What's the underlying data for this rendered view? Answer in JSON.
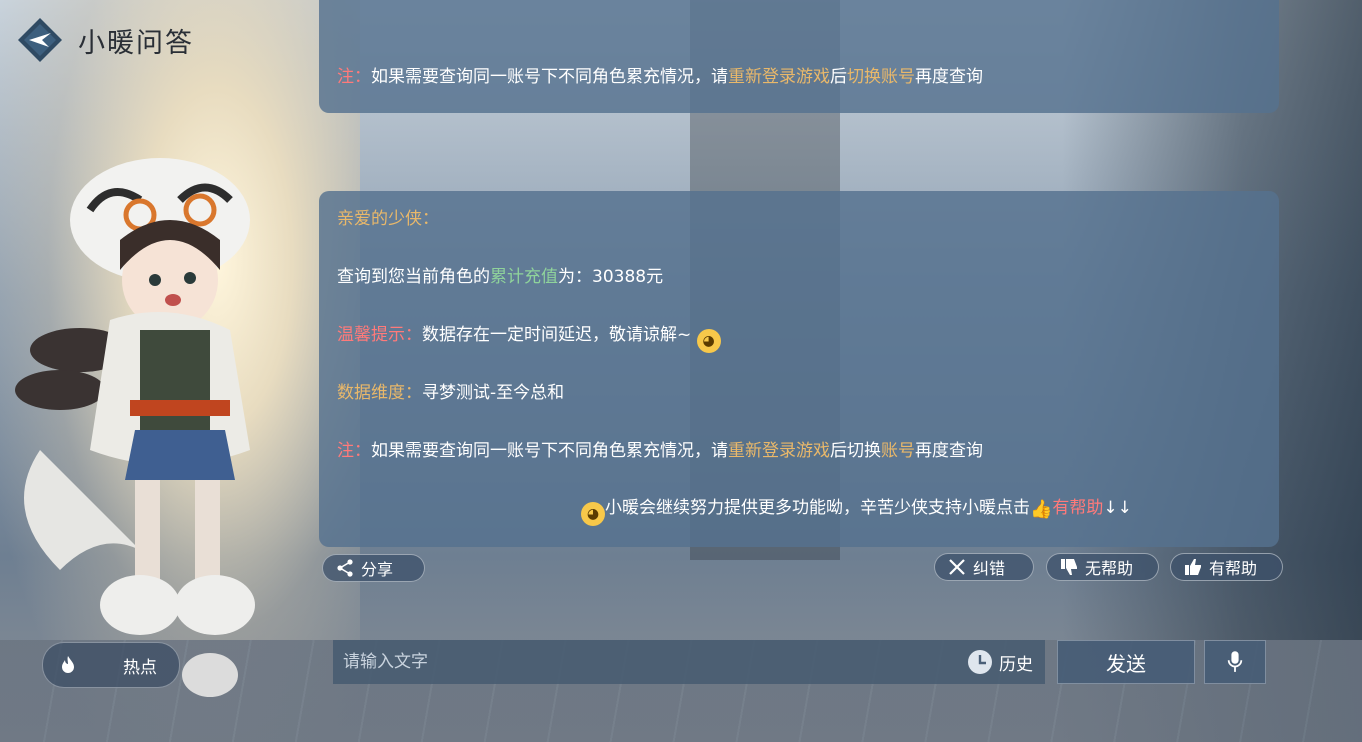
{
  "header": {
    "title": "小暖问答",
    "logo_icon": "diamond-logo-icon"
  },
  "prev_message": {
    "note_label": "注：",
    "text_a": "如果需要查询同一账号下不同角色累充情况，请",
    "hl1": "重新登录游戏",
    "text_b": "后",
    "hl2": "切换账号",
    "text_c": "再度查询"
  },
  "message": {
    "greeting": "亲爱的少侠：",
    "query_pre": "查询到您当前角色的",
    "query_hl": "累计充值",
    "query_post": "为：30388元",
    "tip_label": "温馨提示：",
    "tip_text": "数据存在一定时间延迟，敬请谅解~",
    "dim_label": "数据维度：",
    "dim_text": "寻梦测试-至今总和",
    "note_label": "注：",
    "note_a": "如果需要查询同一账号下不同角色累充情况，请",
    "note_hl1": "重新登录游戏",
    "note_b": "后切换",
    "note_hl2": "账号",
    "note_c": "再度查询",
    "footer_text": "小暖会继续努力提供更多功能呦，辛苦少侠支持小暖点击",
    "footer_hl": "有帮助",
    "footer_arrows": "↓↓"
  },
  "actions": {
    "share": "分享",
    "correct": "纠错",
    "unhelpful": "无帮助",
    "helpful": "有帮助"
  },
  "bottom": {
    "hot": "热点",
    "input_placeholder": "请输入文字",
    "history": "历史",
    "send": "发送"
  },
  "colors": {
    "gold": "#e9b86a",
    "green": "#8fd39b",
    "red": "#ff7a7a",
    "bubble": "#56718f"
  }
}
